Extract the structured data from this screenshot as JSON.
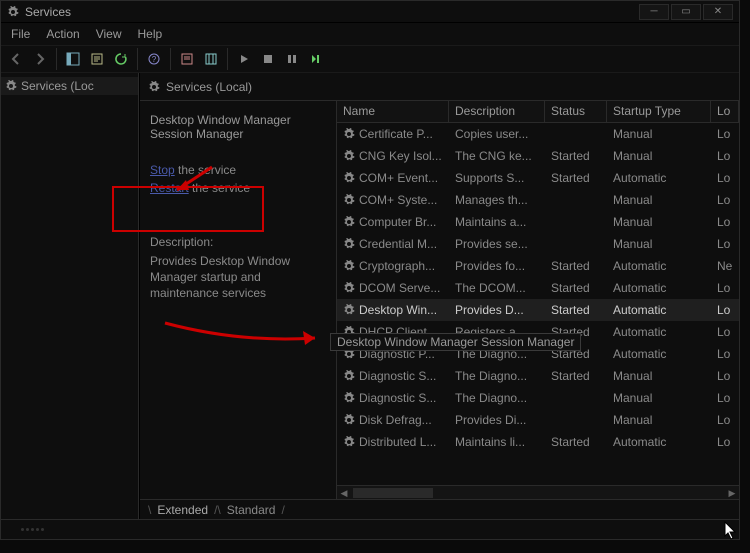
{
  "window": {
    "title": "Services"
  },
  "menu": {
    "file": "File",
    "action": "Action",
    "view": "View",
    "help": "Help"
  },
  "tree": {
    "root": "Services (Loc"
  },
  "panel": {
    "title": "Services (Local)"
  },
  "details": {
    "serviceTitle": "Desktop Window Manager Session Manager",
    "stopLink": "Stop",
    "stopRest": " the service",
    "restartLink": "Restart",
    "restartRest": " the service",
    "descHead": "Description:",
    "descBody": "Provides Desktop Window Manager startup and maintenance services"
  },
  "columns": {
    "name": "Name",
    "desc": "Description",
    "status": "Status",
    "startup": "Startup Type",
    "logon": "Lo"
  },
  "tooltip": "Desktop Window Manager Session Manager",
  "tabs": {
    "extended": "Extended",
    "standard": "Standard"
  },
  "services": [
    {
      "name": "Certificate P...",
      "desc": "Copies user...",
      "status": "",
      "startup": "Manual",
      "logon": "Lo"
    },
    {
      "name": "CNG Key Isol...",
      "desc": "The CNG ke...",
      "status": "Started",
      "startup": "Manual",
      "logon": "Lo"
    },
    {
      "name": "COM+ Event...",
      "desc": "Supports S...",
      "status": "Started",
      "startup": "Automatic",
      "logon": "Lo"
    },
    {
      "name": "COM+ Syste...",
      "desc": "Manages th...",
      "status": "",
      "startup": "Manual",
      "logon": "Lo"
    },
    {
      "name": "Computer Br...",
      "desc": "Maintains a...",
      "status": "",
      "startup": "Manual",
      "logon": "Lo"
    },
    {
      "name": "Credential M...",
      "desc": "Provides se...",
      "status": "",
      "startup": "Manual",
      "logon": "Lo"
    },
    {
      "name": "Cryptograph...",
      "desc": "Provides fo...",
      "status": "Started",
      "startup": "Automatic",
      "logon": "Ne"
    },
    {
      "name": "DCOM Serve...",
      "desc": "The DCOM...",
      "status": "Started",
      "startup": "Automatic",
      "logon": "Lo"
    },
    {
      "name": "Desktop Win...",
      "desc": "Provides D...",
      "status": "Started",
      "startup": "Automatic",
      "logon": "Lo"
    },
    {
      "name": "DHCP Client",
      "desc": "Registers a...",
      "status": "Started",
      "startup": "Automatic",
      "logon": "Lo"
    },
    {
      "name": "Diagnostic P...",
      "desc": "The Diagno...",
      "status": "Started",
      "startup": "Automatic",
      "logon": "Lo"
    },
    {
      "name": "Diagnostic S...",
      "desc": "The Diagno...",
      "status": "Started",
      "startup": "Manual",
      "logon": "Lo"
    },
    {
      "name": "Diagnostic S...",
      "desc": "The Diagno...",
      "status": "",
      "startup": "Manual",
      "logon": "Lo"
    },
    {
      "name": "Disk Defrag...",
      "desc": "Provides Di...",
      "status": "",
      "startup": "Manual",
      "logon": "Lo"
    },
    {
      "name": "Distributed L...",
      "desc": "Maintains li...",
      "status": "Started",
      "startup": "Automatic",
      "logon": "Lo"
    }
  ]
}
